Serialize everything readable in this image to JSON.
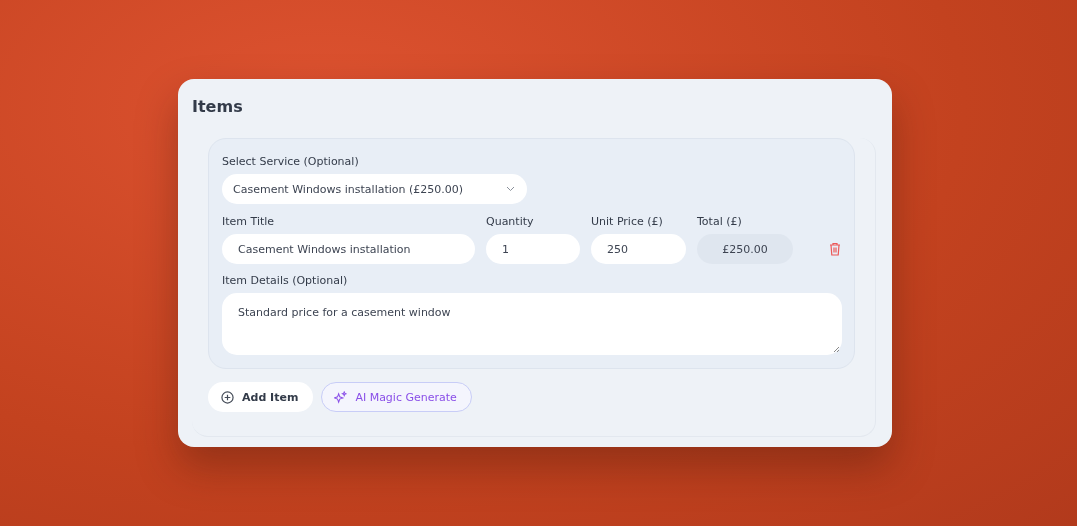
{
  "title": "Items",
  "item": {
    "service_label": "Select Service (Optional)",
    "service_value": "Casement Windows installation (£250.00)",
    "fields": [
      {
        "label": "Item Title",
        "value": "Casement Windows installation",
        "kind": "text"
      },
      {
        "label": "Quantity",
        "value": "1",
        "kind": "text"
      },
      {
        "label": "Unit Price (£)",
        "value": "250",
        "kind": "text"
      },
      {
        "label": "Total (£)",
        "value": "£250.00",
        "kind": "readonly"
      }
    ],
    "details_label": "Item Details (Optional)",
    "details_value": "Standard price for a casement window"
  },
  "buttons": [
    {
      "label": "Add Item",
      "kind": "add"
    },
    {
      "label": "AI Magic Generate",
      "kind": "ai"
    }
  ]
}
